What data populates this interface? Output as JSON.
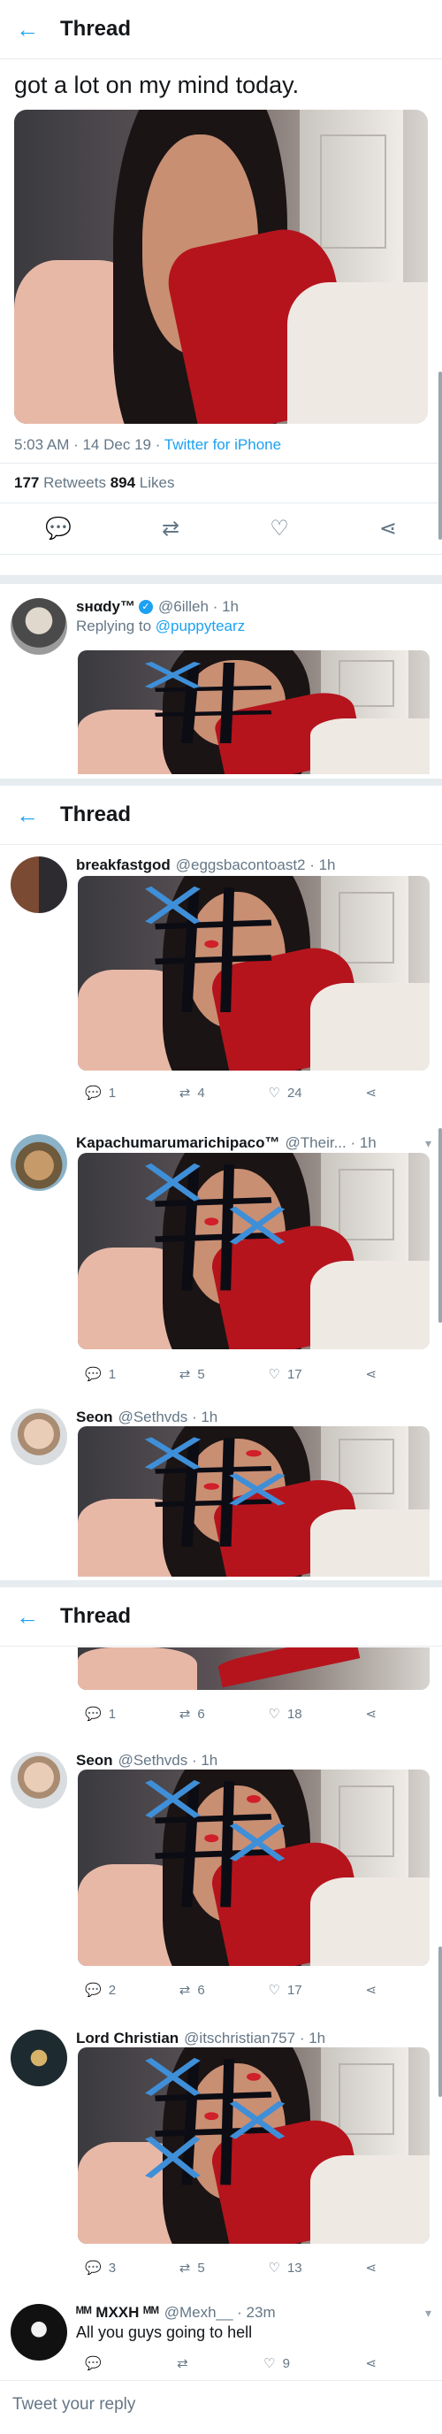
{
  "segment1": {
    "header_title": "Thread",
    "tweet_text": "got a lot on my mind today.",
    "timestamp": "5:03 AM · 14 Dec 19 · ",
    "source": "Twitter for iPhone",
    "retweets_count": "177",
    "retweets_label": " Retweets ",
    "likes_count": "894",
    "likes_label": " Likes",
    "reply": {
      "name": "sнαdу™",
      "handle": "@6illeh · 1h",
      "replying_prefix": "Replying to ",
      "replying_handle": "@puppytearz"
    }
  },
  "segment2": {
    "header_title": "Thread",
    "replies": [
      {
        "name": "breakfastgod",
        "handle": "@eggsbacontoast2 · 1h",
        "replies": "1",
        "retweets": "4",
        "likes": "24"
      },
      {
        "name": "Kapachumarumarichipaco™",
        "handle": "@Their... · 1h",
        "replies": "1",
        "retweets": "5",
        "likes": "17"
      },
      {
        "name": "Seon",
        "handle": "@Sethvds · 1h"
      }
    ]
  },
  "segment3": {
    "header_title": "Thread",
    "top_actions": {
      "replies": "1",
      "retweets": "6",
      "likes": "18"
    },
    "replies": [
      {
        "name": "Seon",
        "handle": "@Sethvds · 1h",
        "replies": "2",
        "retweets": "6",
        "likes": "17"
      },
      {
        "name": "Lord Christian",
        "handle": "@itschristian757 · 1h",
        "replies": "3",
        "retweets": "5",
        "likes": "13"
      },
      {
        "name": "ᴹᴹ MXXH ᴹᴹ",
        "handle": "@Mexh__ · 23m",
        "text": "All you guys going to hell",
        "likes": "9"
      }
    ],
    "reply_placeholder": "Tweet your reply"
  },
  "colors": {
    "accent": "#1da1f2",
    "muted": "#657786",
    "divider": "#e6ecf0"
  },
  "icons": [
    "back-arrow-icon",
    "reply-icon",
    "retweet-icon",
    "like-icon",
    "share-icon",
    "chevron-down-icon",
    "verified-icon"
  ]
}
